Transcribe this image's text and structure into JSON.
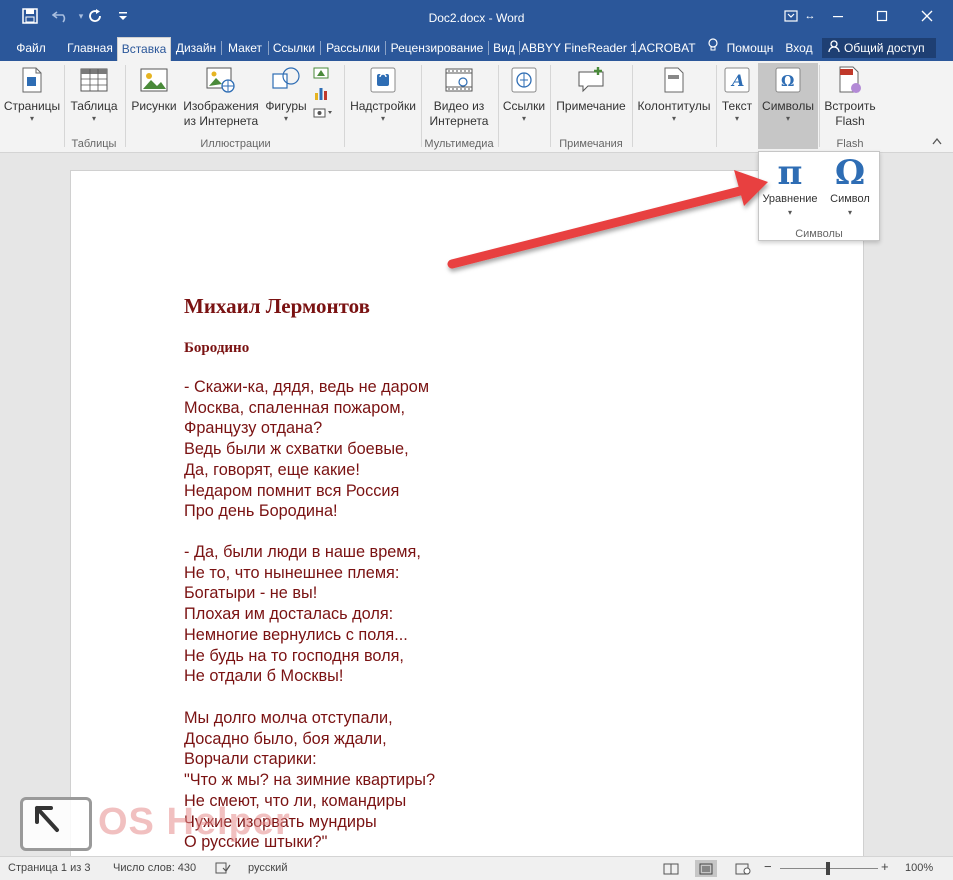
{
  "title_bar": {
    "document_title": "Doc2.docx - Word",
    "quick_access": [
      "save-icon",
      "undo-icon",
      "redo-icon",
      "customize-icon"
    ],
    "window_controls": [
      "ribbon-display-icon",
      "restore-icon",
      "minimize-icon",
      "maximize-icon",
      "close-icon"
    ]
  },
  "tabs": [
    {
      "label": "Файл"
    },
    {
      "label": "Главная"
    },
    {
      "label": "Вставка",
      "active": true
    },
    {
      "label": "Дизайн"
    },
    {
      "label": "Макет"
    },
    {
      "label": "Ссылки"
    },
    {
      "label": "Рассылки"
    },
    {
      "label": "Рецензирование"
    },
    {
      "label": "Вид"
    },
    {
      "label": "ABBYY FineReader 1."
    },
    {
      "label": "ACROBAT"
    },
    {
      "label": "Помощн"
    },
    {
      "label": "Вход"
    }
  ],
  "share_label": "Общий доступ",
  "ribbon": {
    "pages": "Страницы",
    "table": "Таблица",
    "pictures": "Рисунки",
    "online_pictures_1": "Изображения",
    "online_pictures_2": "из Интернета",
    "shapes": "Фигуры",
    "addins": "Надстройки",
    "online_video_1": "Видео из",
    "online_video_2": "Интернета",
    "links": "Ссылки",
    "comment": "Примечание",
    "header_footer": "Колонтитулы",
    "text": "Текст",
    "symbols": "Символы",
    "embed_flash_1": "Встроить",
    "embed_flash_2": "Flash",
    "groups": {
      "tables": "Таблицы",
      "illustrations": "Иллюстрации",
      "multimedia": "Мультимедиа",
      "comments": "Примечания",
      "flash": "Flash"
    }
  },
  "symbols_dropdown": {
    "equation_glyph": "π",
    "equation_label": "Уравнение",
    "symbol_glyph": "Ω",
    "symbol_label": "Символ",
    "group_label": "Символы"
  },
  "document": {
    "heading": "Михаил Лермонтов",
    "subheading": "Бородино",
    "stanzas": [
      [
        "- Скажи-ка, дядя, ведь не даром",
        "Москва, спаленная пожаром,",
        "Французу отдана?",
        "Ведь были ж схватки боевые,",
        "Да, говорят, еще какие!",
        "Недаром помнит вся Россия",
        "Про день Бородина!"
      ],
      [
        "- Да, были люди в наше время,",
        "Не то, что нынешнее племя:",
        "Богатыри - не вы!",
        "Плохая им досталась доля:",
        "Немногие вернулись с поля...",
        "Не будь на то господня воля,",
        "Не отдали б Москвы!"
      ],
      [
        "Мы долго молча отступали,",
        "Досадно было, боя ждали,",
        "Ворчали старики:",
        "\"Что ж мы? на зимние квартиры?",
        "Не смеют, что ли, командиры",
        "Чужие изорвать мундиры",
        "О русские штыки?\""
      ]
    ],
    "text_color": "#7a1212"
  },
  "watermark": {
    "text": "OS Helper"
  },
  "status_bar": {
    "page": "Страница 1 из 3",
    "words": "Число слов: 430",
    "language": "русский",
    "zoom": "100%",
    "zoom_minus": "−",
    "zoom_plus": "+"
  },
  "colors": {
    "title_bar": "#2b579a",
    "active_tab": "#f3f3f3",
    "accent_arrow": "#e84040",
    "glyph_blue": "#2e6db4"
  }
}
